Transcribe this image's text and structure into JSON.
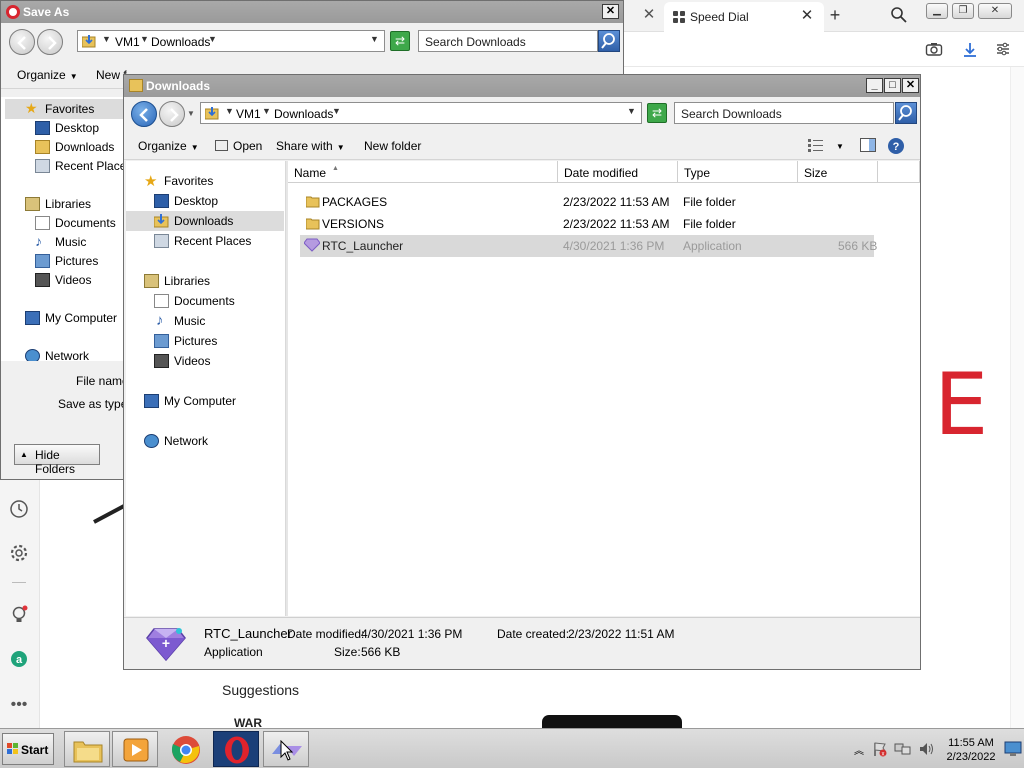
{
  "browser": {
    "tab_title": "Speed Dial",
    "page_letter": "E",
    "suggestions_label": "Suggestions",
    "war_text": "WAR"
  },
  "save_as": {
    "title": "Save As",
    "crumbs": [
      "VM1",
      "Downloads"
    ],
    "search_placeholder": "Search Downloads",
    "organize": "Organize",
    "new_folder": "New f",
    "nav": {
      "favorites": "Favorites",
      "desktop": "Desktop",
      "downloads": "Downloads",
      "recent": "Recent Places",
      "libraries": "Libraries",
      "documents": "Documents",
      "music": "Music",
      "pictures": "Pictures",
      "videos": "Videos",
      "computer": "My Computer",
      "network": "Network"
    },
    "file_name_label": "File name",
    "save_as_type_label": "Save as type",
    "hide_folders": "Hide Folders"
  },
  "downloads": {
    "title": "Downloads",
    "crumbs": [
      "VM1",
      "Downloads"
    ],
    "search_placeholder": "Search Downloads",
    "toolbar": {
      "organize": "Organize",
      "open": "Open",
      "share_with": "Share with",
      "new_folder": "New folder"
    },
    "nav": {
      "favorites": "Favorites",
      "desktop": "Desktop",
      "downloads": "Downloads",
      "recent": "Recent Places",
      "libraries": "Libraries",
      "documents": "Documents",
      "music": "Music",
      "pictures": "Pictures",
      "videos": "Videos",
      "computer": "My Computer",
      "network": "Network"
    },
    "columns": {
      "name": "Name",
      "date": "Date modified",
      "type": "Type",
      "size": "Size"
    },
    "rows": [
      {
        "name": "PACKAGES",
        "date": "2/23/2022 11:53 AM",
        "type": "File folder",
        "size": ""
      },
      {
        "name": "VERSIONS",
        "date": "2/23/2022 11:53 AM",
        "type": "File folder",
        "size": ""
      },
      {
        "name": "RTC_Launcher",
        "date": "4/30/2021 1:36 PM",
        "type": "Application",
        "size": "566 KB"
      }
    ],
    "details": {
      "name": "RTC_Launcher",
      "type": "Application",
      "date_modified_label": "Date modified:",
      "date_modified": "4/30/2021 1:36 PM",
      "size_label": "Size:",
      "size": "566 KB",
      "date_created_label": "Date created:",
      "date_created": "2/23/2022 11:51 AM"
    }
  },
  "taskbar": {
    "start": "Start",
    "time": "11:55 AM",
    "date": "2/23/2022"
  },
  "colors": {
    "titlebar": "#a0a0a0",
    "opera_red": "#d8252f",
    "go_green": "#3ea84a",
    "search_blue": "#2f5fa8"
  }
}
